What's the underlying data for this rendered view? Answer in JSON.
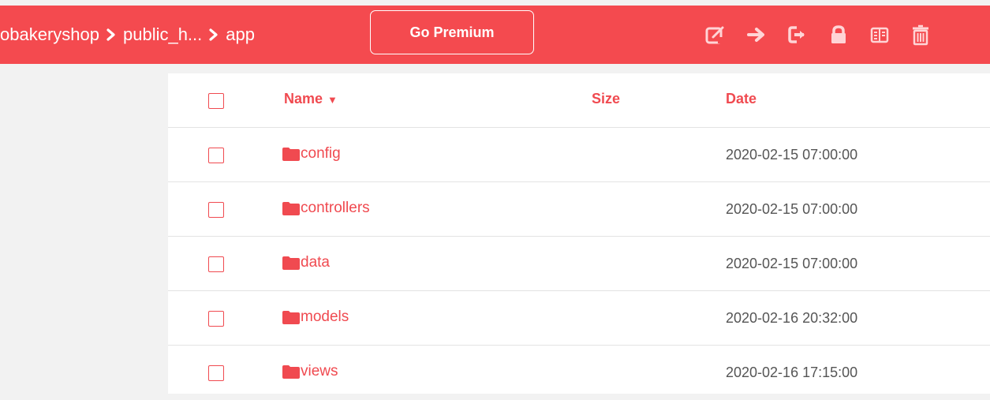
{
  "breadcrumb": {
    "items": [
      "obakeryshop",
      "public_h...",
      "app"
    ]
  },
  "toolbar": {
    "premium_label": "Go Premium",
    "icons": [
      "edit-icon",
      "move-icon",
      "export-icon",
      "lock-icon",
      "archive-icon",
      "trash-icon"
    ]
  },
  "table": {
    "headers": {
      "name": "Name",
      "sort_indicator": "▼",
      "size": "Size",
      "date": "Date"
    },
    "rows": [
      {
        "name": "config",
        "size": "",
        "date": "2020-02-15 07:00:00"
      },
      {
        "name": "controllers",
        "size": "",
        "date": "2020-02-15 07:00:00"
      },
      {
        "name": "data",
        "size": "",
        "date": "2020-02-15 07:00:00"
      },
      {
        "name": "models",
        "size": "",
        "date": "2020-02-16 20:32:00"
      },
      {
        "name": "views",
        "size": "",
        "date": "2020-02-16 17:15:00"
      }
    ]
  },
  "colors": {
    "accent": "#f44a4f",
    "text_muted": "#555555"
  }
}
